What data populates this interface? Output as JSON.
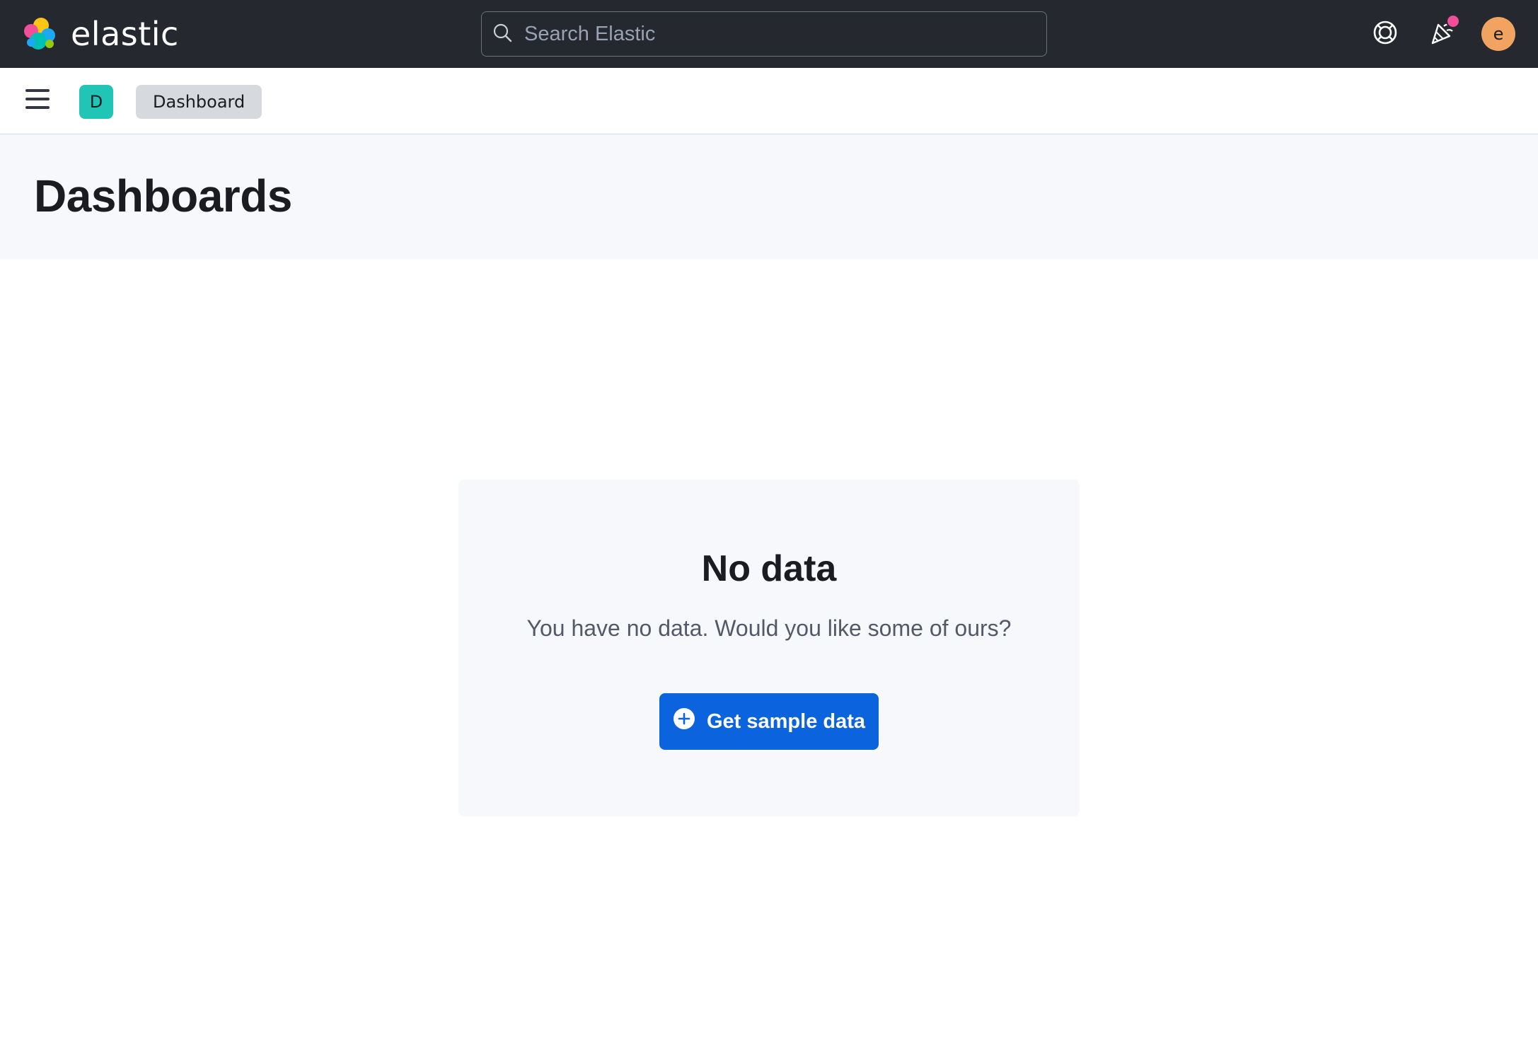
{
  "header": {
    "brand_name": "elastic",
    "search": {
      "placeholder": "Search Elastic",
      "value": ""
    },
    "icons": [
      "help-icon",
      "newsfeed-icon"
    ],
    "news_badge_color": "#f04e98",
    "user_avatar_initial": "e",
    "user_avatar_color": "#f1a35f"
  },
  "subheader": {
    "space_initial": "D",
    "space_color": "#20c5b5",
    "breadcrumb": "Dashboard"
  },
  "page": {
    "title": "Dashboards"
  },
  "empty_state": {
    "title": "No data",
    "body": "You have no data. Would you like some of ours?",
    "button_label": "Get sample data",
    "button_color": "#0b64dd"
  }
}
